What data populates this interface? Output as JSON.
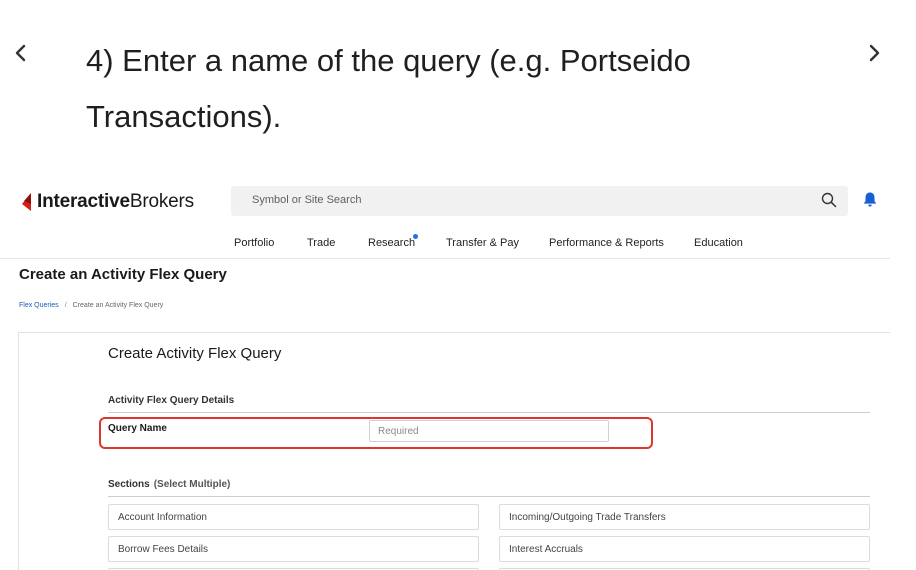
{
  "tutorial": {
    "step_text": "4) Enter a name of the query (e.g. Portseido Transactions).",
    "prev_icon": "chevron-left-icon",
    "next_icon": "chevron-right-icon"
  },
  "header": {
    "logo": {
      "bold": "Interactive",
      "regular": "Brokers",
      "mark_color": "#d81b1b"
    },
    "search": {
      "placeholder": "Symbol or Site Search",
      "icon": "search-icon"
    },
    "bell_icon": "bell-icon",
    "accent_color": "#1a73e8"
  },
  "nav": {
    "items": [
      "Portfolio",
      "Trade",
      "Research",
      "Transfer & Pay",
      "Performance & Reports",
      "Education"
    ]
  },
  "page": {
    "title": "Create an Activity Flex Query",
    "breadcrumb": {
      "link": "Flex Queries",
      "separator": "/",
      "current": "Create an Activity Flex Query"
    }
  },
  "form": {
    "title": "Create Activity Flex Query",
    "details_heading": "Activity Flex Query Details",
    "query_name_label": "Query Name",
    "query_name_placeholder": "Required",
    "query_name_value": "",
    "highlight_color": "#e0352b",
    "sections_heading": "Sections",
    "sections_hint": "(Select Multiple)",
    "sections": [
      "Account Information",
      "Incoming/Outgoing Trade Transfers",
      "Borrow Fees Details",
      "Interest Accruals"
    ]
  }
}
